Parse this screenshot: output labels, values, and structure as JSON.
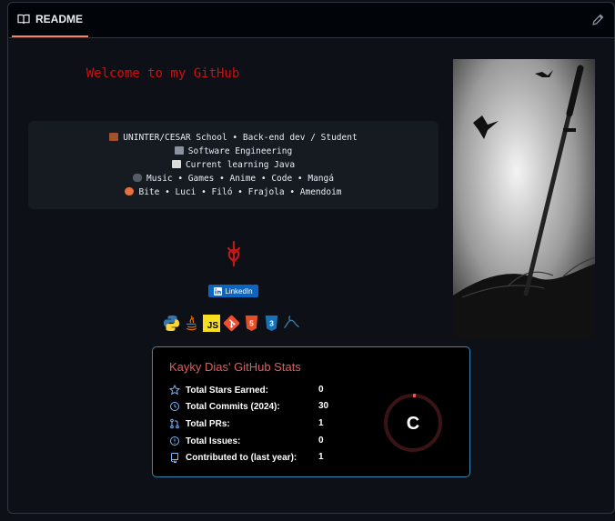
{
  "header": {
    "tab_label": "README",
    "edit_icon": "pencil-icon"
  },
  "readme": {
    "welcome": "Welcome to my GitHub",
    "lines": [
      {
        "icon": "school-icon",
        "text": "UNINTER/CESAR School • Back-end dev / Student"
      },
      {
        "icon": "laptop-icon",
        "text": "Software Engineering"
      },
      {
        "icon": "book-icon",
        "text": "Current learning Java"
      },
      {
        "icon": "gamepad-icon",
        "text": "Music • Games • Anime • Code • Mangá"
      },
      {
        "icon": "paw-icon",
        "text": "Bite • Luci • Filó • Frajola • Amendoim"
      }
    ],
    "linkedin": "LinkedIn",
    "tech_icons": [
      "python-icon",
      "java-icon",
      "javascript-icon",
      "git-icon",
      "html5-icon",
      "css3-icon",
      "mysql-icon"
    ],
    "js_label": "JS",
    "html_label": "5",
    "css_label": "3"
  },
  "stats": {
    "title": "Kayky Dias' GitHub Stats",
    "rows": [
      {
        "icon": "star-icon",
        "label": "Total Stars Earned:",
        "value": "0"
      },
      {
        "icon": "history-icon",
        "label": "Total Commits (2024):",
        "value": "30"
      },
      {
        "icon": "pull-request-icon",
        "label": "Total PRs:",
        "value": "1"
      },
      {
        "icon": "issue-icon",
        "label": "Total Issues:",
        "value": "0"
      },
      {
        "icon": "repo-icon",
        "label": "Contributed to (last year):",
        "value": "1"
      }
    ],
    "rank": "C",
    "accent": "#e05d5d",
    "border": "#3a86b0"
  }
}
